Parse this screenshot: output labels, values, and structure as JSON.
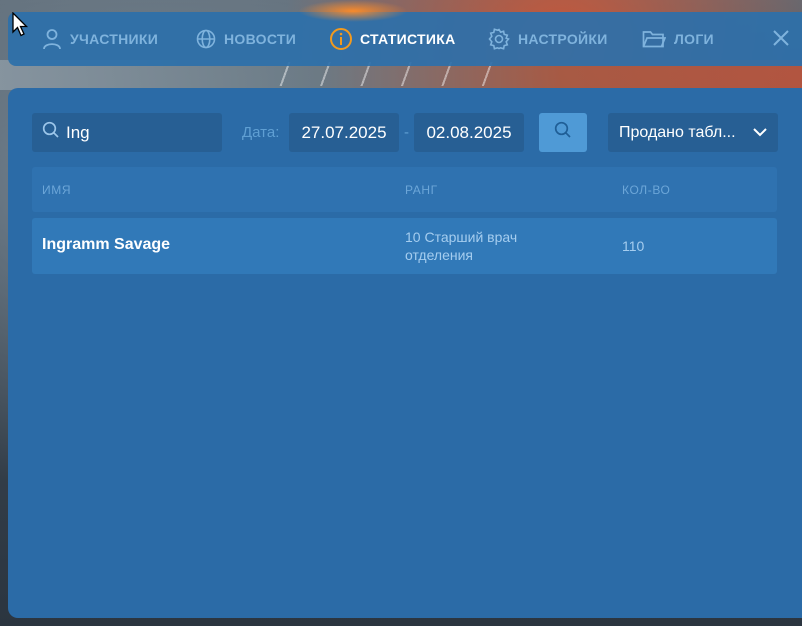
{
  "nav": {
    "items": [
      {
        "label": "УЧАСТНИКИ",
        "icon": "user-icon"
      },
      {
        "label": "НОВОСТИ",
        "icon": "globe-icon"
      },
      {
        "label": "СТАТИСТИКА",
        "icon": "info-icon",
        "active": true
      },
      {
        "label": "НАСТРОЙКИ",
        "icon": "gear-icon"
      },
      {
        "label": "ЛОГИ",
        "icon": "folder-icon"
      }
    ],
    "close_icon": "close-icon"
  },
  "filters": {
    "search_value": "Ing",
    "date_label": "Дата:",
    "date_from": "27.07.2025",
    "date_separator": "-",
    "date_to": "02.08.2025",
    "dropdown_selected": "Продано табл..."
  },
  "table": {
    "headers": [
      "ИМЯ",
      "РАНГ",
      "КОЛ-ВО"
    ],
    "rows": [
      {
        "name": "Ingramm Savage",
        "rank": "10 Старший врач отделения",
        "qty": "110"
      }
    ]
  },
  "colors": {
    "panel": "#2b6ba7",
    "nav_active": "#ffffff",
    "nav_inactive": "#7fb3dd",
    "accent_orange": "#f39a1e"
  }
}
